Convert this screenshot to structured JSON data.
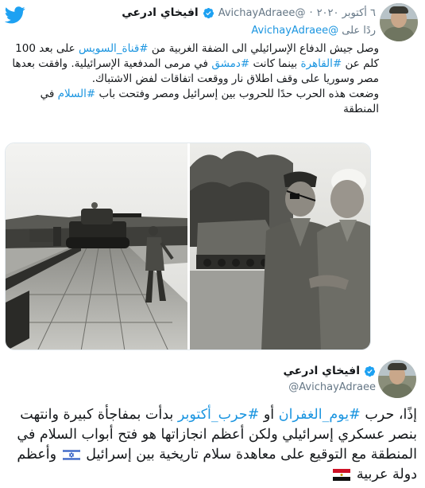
{
  "tweet1": {
    "author_name": "افيخاي ادرعي",
    "handle": "@AvichayAdraee",
    "separator": "·",
    "date": "٦ أكتوبر ٢٠٢٠",
    "reply_prefix": "ردًا على",
    "reply_mention": "@AvichayAdraee",
    "paragraph1": [
      {
        "t": "وصل جيش الدفاع الإسرائيلي الى الضفة الغربية من ",
        "h": false
      },
      {
        "t": "#قناة_السويس",
        "h": true
      },
      {
        "t": " على بعد 100 كلم عن ",
        "h": false
      },
      {
        "t": "#القاهرة",
        "h": true
      },
      {
        "t": " بينما كانت ",
        "h": false
      },
      {
        "t": "#دمشق",
        "h": true
      },
      {
        "t": " في مرمى المدفعية الإسرائيلية. وافقت بعدها مصر وسوريا على وقف اطلاق نار ووقعت اتفاقات لفض الاشتباك.",
        "h": false
      }
    ],
    "paragraph2": [
      {
        "t": "وضعت هذه الحرب حدًا للحروب بين إسرائيل ومصر وفتحت باب ",
        "h": false
      },
      {
        "t": "#السلام",
        "h": true
      },
      {
        "t": " في المنطقة",
        "h": false
      }
    ]
  },
  "tweet2": {
    "author_name": "افيخاي ادرعي",
    "handle": "@AvichayAdraee",
    "body": [
      {
        "t": "إذًا، حرب ",
        "h": false
      },
      {
        "t": "#يوم_الغفران",
        "h": true
      },
      {
        "t": " أو ",
        "h": false
      },
      {
        "t": "#حرب_أكتوبر",
        "h": true
      },
      {
        "t": " بدأت بمفاجأة كبيرة وانتهت بنصر عسكري إسرائيلي ولكن أعظم انجازاتها هو فتح أبواب السلام في المنطقة مع التوقيع على معاهدة سلام تاريخية بين إسرائيل ",
        "h": false
      }
    ],
    "body_end": "وأعظم دولة عربية"
  },
  "colors": {
    "link": "#1b95e0",
    "text": "#14171a",
    "secondary": "#657786",
    "twitter_blue": "#1da1f2"
  },
  "icons": {
    "brand": "twitter-bird-icon",
    "verified": "verified-badge-icon",
    "flag_israel": "israel-flag-icon",
    "flag_egypt": "egypt-flag-icon"
  }
}
